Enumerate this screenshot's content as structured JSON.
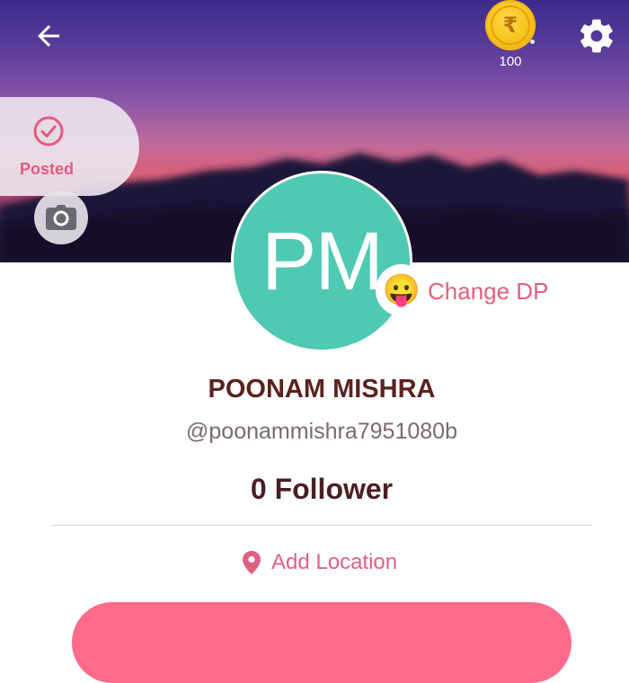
{
  "header": {
    "back_icon": "arrow-left-icon",
    "coin_icon": "rupee-coin-icon",
    "coin_symbol": "₹",
    "coin_count": "100",
    "settings_icon": "gear-icon"
  },
  "posted": {
    "label": "Posted",
    "icon": "check-circle-icon"
  },
  "camera": {
    "icon": "camera-icon"
  },
  "profile": {
    "initials": "PM",
    "avatar_color": "#4ec9b2",
    "emoji": "😛",
    "change_dp_label": "Change DP",
    "name": "POONAM MISHRA",
    "handle": "@poonammishra7951080b",
    "followers": "0 Follower"
  },
  "location": {
    "icon": "map-pin-icon",
    "label": "Add Location"
  },
  "colors": {
    "accent": "#e2607c",
    "name_text": "#5b2220",
    "button": "#fd6a8a"
  }
}
